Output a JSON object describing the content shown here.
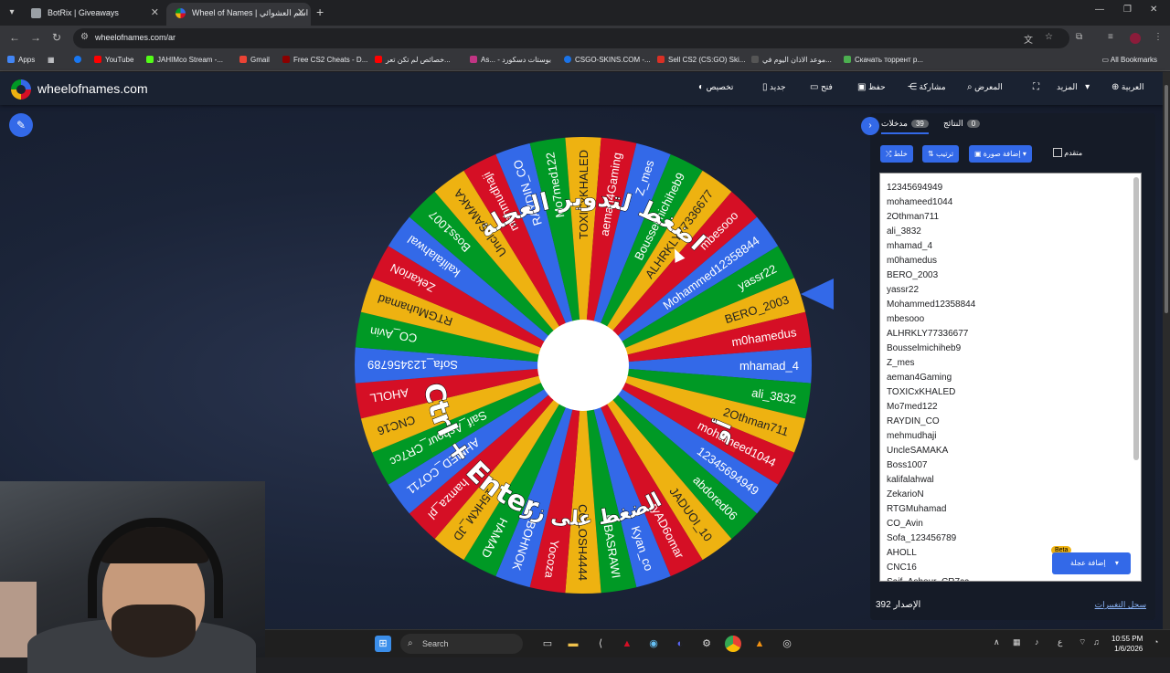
{
  "browser": {
    "tabs": [
      {
        "title": "BotRix | Giveaways",
        "favicon_color": "#9aa0a6"
      },
      {
        "title": "Wheel of Names | اسم العشوائي",
        "favicon_color": "#3369e8"
      }
    ],
    "url": "wheelofnames.com/ar",
    "bookmarks": [
      {
        "label": "Apps",
        "color": "#4285f4"
      },
      {
        "label": "YouTube",
        "color": "#ff0000"
      },
      {
        "label": "JAHIMco Stream -...",
        "color": "#53fc18"
      },
      {
        "label": "Gmail",
        "color": "#ea4335"
      },
      {
        "label": "Free CS2 Cheats - D...",
        "color": "#8b0000"
      },
      {
        "label": "خصائص لم تكن تعر...",
        "color": "#ff0000"
      },
      {
        "label": "As... - بوستات دسكورد",
        "color": "#c13584"
      },
      {
        "label": "CSGO-SKINS.COM -...",
        "color": "#1a73e8"
      },
      {
        "label": "Sell CS2 (CS:GO) Ski...",
        "color": "#d93025"
      },
      {
        "label": "موعد الاذان اليوم في...",
        "color": "#555555"
      },
      {
        "label": "Скачать торрент р...",
        "color": "#4caf50"
      }
    ],
    "all_bookmarks": "All Bookmarks"
  },
  "site": {
    "title": "wheelofnames.com",
    "menu": [
      {
        "label": "تخصيص",
        "icon": "palette-icon"
      },
      {
        "label": "جديد",
        "icon": "file-icon"
      },
      {
        "label": "فتح",
        "icon": "folder-icon"
      },
      {
        "label": "حفظ",
        "icon": "save-icon"
      },
      {
        "label": "مشاركة",
        "icon": "share-icon"
      },
      {
        "label": "المعرض",
        "icon": "search-icon"
      },
      {
        "label": "",
        "icon": "fullscreen-icon"
      },
      {
        "label": "المزيد",
        "icon": "chevron-down-icon"
      },
      {
        "label": "العربية",
        "icon": "globe-icon"
      }
    ]
  },
  "wheel": {
    "center_text": "اضغط لتدوير العجلة",
    "or_text": "أو",
    "shortcut_text": "Ctrl + Enter",
    "press_text": "الضغط على زر",
    "colors": [
      "#3369e8",
      "#009925",
      "#eeb211",
      "#d50f25"
    ],
    "labels": [
      "mhamad_4",
      "ali_3832",
      "2Othman711",
      "mohameed1044",
      "12345694949",
      "abdored06",
      "JADUOI_10",
      "ryAD6omar",
      "Kyan_co",
      "MBASRAWI",
      "COLOSH4444",
      "Yocoza",
      "BOHNOK",
      "HAMAD",
      "15HKM_JD",
      "hamza_pl",
      "AHMED_CO711",
      "Saif_Ashour_CR7cc",
      "CNC16",
      "AHOLL",
      "Sofa_123456789",
      "CO_Avin",
      "RTGMuhamad",
      "ZekarioN",
      "kalifalahwal",
      "Boss1007",
      "UncleSAMAKA",
      "mehmudhaji",
      "RAYDIN_CO",
      "Mo7med122",
      "TOXICxKHALED",
      "aeman4Gaming",
      "Z_mes",
      "Bousselmichiheb9",
      "ALHRKLY77336677",
      "mbesooo",
      "Mohammed12358844",
      "yassr22",
      "BERO_2003",
      "m0hamedus"
    ]
  },
  "panel": {
    "tab_entries": "مدخلات",
    "entries_count": "39",
    "tab_results": "النتائج",
    "results_count": "0",
    "shuffle": "خلط",
    "sort": "ترتيب",
    "add_image": "إضافة صورة",
    "advanced": "متقدم",
    "entries": [
      "12345694949",
      "mohameed1044",
      "2Othman711",
      "ali_3832",
      "mhamad_4",
      "m0hamedus",
      "BERO_2003",
      "yassr22",
      "Mohammed12358844",
      "mbesooo",
      "ALHRKLY77336677",
      "Bousselmichiheb9",
      "Z_mes",
      "aeman4Gaming",
      "TOXICxKHALED",
      "Mo7med122",
      "RAYDIN_CO",
      "mehmudhaji",
      "UncleSAMAKA",
      "Boss1007",
      "kalifalahwal",
      "ZekarioN",
      "RTGMuhamad",
      "CO_Avin",
      "Sofa_123456789",
      "AHOLL",
      "CNC16",
      "Saif_Ashour_CR7cc"
    ],
    "add_wheel": "إضافة عجلة",
    "beta": "Beta",
    "version_label": "الإصدار",
    "version": "392",
    "changelog": "سجل التغييرات"
  },
  "taskbar": {
    "search": "Search",
    "lang": "ع",
    "time": "10:55 PM",
    "date": "1/6/2026"
  }
}
